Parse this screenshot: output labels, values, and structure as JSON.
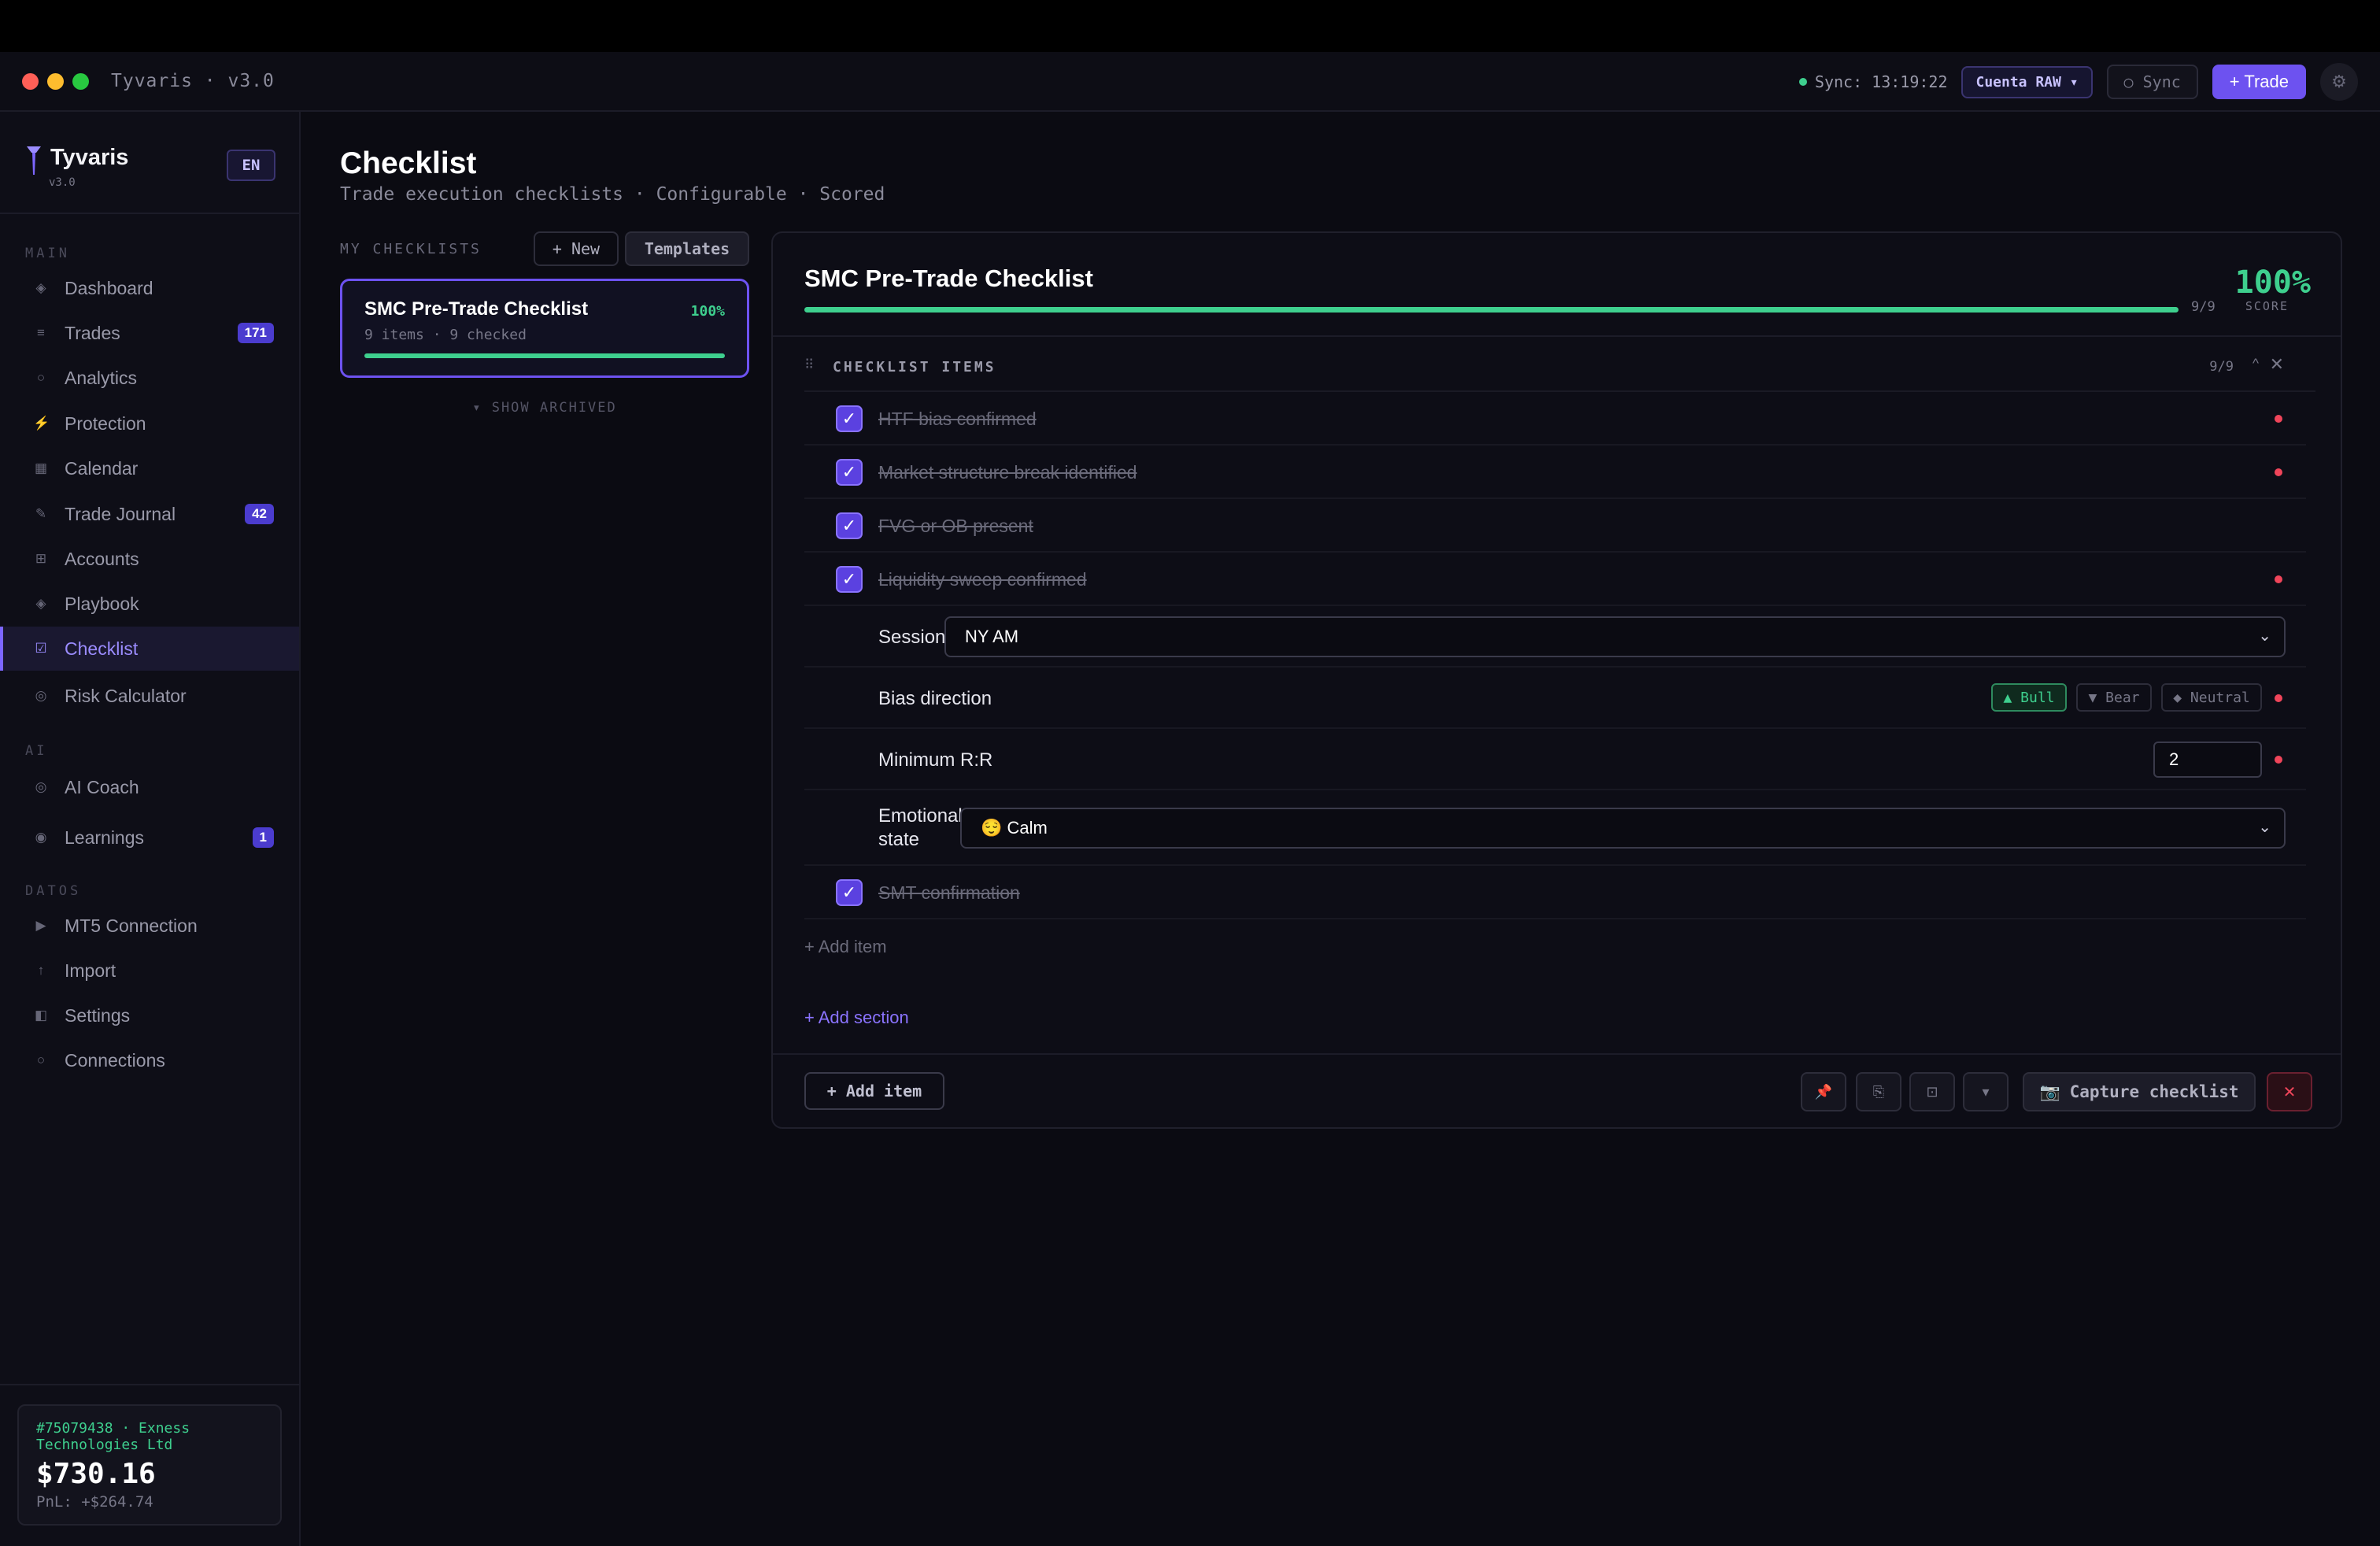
{
  "window": {
    "title": "Tyvaris · v3.0",
    "sync_status": "Sync: 13:19:22",
    "account_selector": "Cuenta RAW ▾",
    "sync_button": "○ Sync",
    "trade_button": "+ Trade",
    "settings_icon": "gear-icon"
  },
  "sidebar": {
    "brand": {
      "name": "Tyvaris",
      "version": "v3.0",
      "lang": "EN"
    },
    "sections": {
      "main": "MAIN",
      "ai": "AI",
      "datos": "DATOS"
    },
    "items": [
      {
        "label": "Dashboard",
        "icon": "◈"
      },
      {
        "label": "Trades",
        "icon": "≡",
        "badge": "171"
      },
      {
        "label": "Analytics",
        "icon": "○"
      },
      {
        "label": "Protection",
        "icon": "⚡"
      },
      {
        "label": "Calendar",
        "icon": "▦"
      },
      {
        "label": "Trade Journal",
        "icon": "✎",
        "badge": "42"
      },
      {
        "label": "Accounts",
        "icon": "⊞"
      },
      {
        "label": "Playbook",
        "icon": "◈"
      },
      {
        "label": "Checklist",
        "icon": "☑",
        "active": true
      },
      {
        "label": "Risk Calculator",
        "icon": "◎"
      },
      {
        "label": "AI Coach",
        "icon": "◎"
      },
      {
        "label": "Learnings",
        "icon": "◉",
        "badge": "1"
      },
      {
        "label": "MT5 Connection",
        "icon": "▶"
      },
      {
        "label": "Import",
        "icon": "↑"
      },
      {
        "label": "Settings",
        "icon": "◧"
      },
      {
        "label": "Connections",
        "icon": "○"
      }
    ],
    "account": {
      "id": "#75079438 · Exness Technologies Ltd",
      "balance": "$730.16",
      "pnl": "PnL: +$264.74"
    }
  },
  "page": {
    "title": "Checklist",
    "subtitle": "Trade execution checklists · Configurable · Scored"
  },
  "lists": {
    "label": "MY CHECKLISTS",
    "new_button": "+ New",
    "templates_button": "Templates",
    "show_archived": "▾ SHOW ARCHIVED",
    "cards": [
      {
        "name": "SMC Pre-Trade Checklist",
        "meta": "9 items · 9 checked",
        "percent": "100%",
        "progress": 1.0
      }
    ]
  },
  "detail": {
    "title": "SMC Pre-Trade Checklist",
    "progress": 1.0,
    "count": "9/9",
    "score": "100%",
    "score_label": "SCORE",
    "section": {
      "title": "CHECKLIST ITEMS",
      "count": "9/9",
      "collapse_icon": "^",
      "close_icon": "✕"
    },
    "items": {
      "htf": "HTF bias confirmed",
      "msb": "Market structure break identified",
      "fvg": "FVG or OB present",
      "liq": "Liquidity sweep confirmed",
      "session_label": "Session",
      "session_value": "NY AM",
      "bias_label": "Bias direction",
      "bias_options": [
        "▲ Bull",
        "▼ Bear",
        "◆ Neutral"
      ],
      "bias_selected": "▲ Bull",
      "rr_label": "Minimum R:R",
      "rr_value": "2",
      "emo_label": "Emotional state",
      "emo_value": "😌 Calm",
      "smt": "SMT confirmation"
    },
    "add_item_link": "+ Add item",
    "add_section_link": "+ Add section",
    "footer": {
      "add_item": "+ Add item",
      "capture": "Capture checklist",
      "close": "✕"
    }
  }
}
